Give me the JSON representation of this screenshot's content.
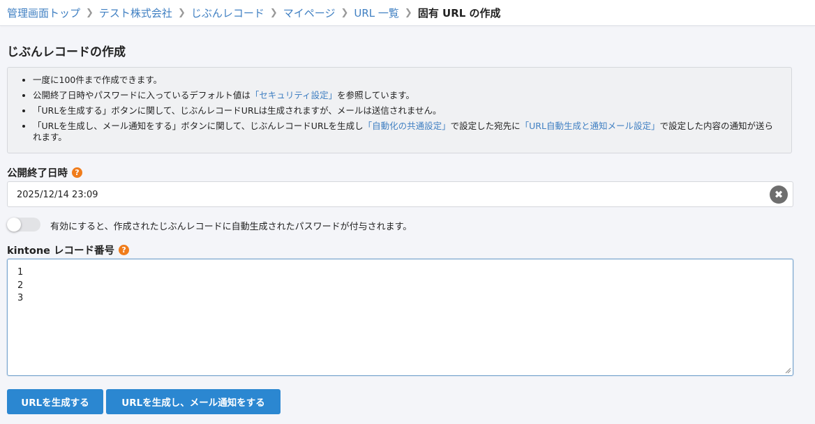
{
  "breadcrumb": {
    "items": [
      "管理画面トップ",
      "テスト株式会社",
      "じぶんレコード",
      "マイページ",
      "URL 一覧"
    ],
    "current": "固有 URL の作成"
  },
  "page_title": "じぶんレコードの作成",
  "notice": {
    "item1": "一度に100件まで作成できます。",
    "item2_pre": "公開終了日時やパスワードに入っているデフォルト値は",
    "item2_link": "「セキュリティ設定」",
    "item2_post": "を参照しています。",
    "item3": "「URLを生成する」ボタンに関して、じぶんレコードURLは生成されますが、メールは送信されません。",
    "item4_pre": "「URLを生成し、メール通知をする」ボタンに関して、じぶんレコードURLを生成し",
    "item4_link1": "「自動化の共通設定」",
    "item4_mid": "で設定した宛先に",
    "item4_link2": "「URL自動生成と通知メール設定」",
    "item4_post": "で設定した内容の通知が送られます。"
  },
  "expiry": {
    "label": "公開終了日時",
    "value": "2025/12/14 23:09"
  },
  "password_toggle": {
    "label": "有効にすると、作成されたじぶんレコードに自動生成されたパスワードが付与されます。",
    "enabled": false
  },
  "record_numbers": {
    "label": "kintone レコード番号",
    "value": "1\n2\n3"
  },
  "buttons": {
    "generate": "URLを生成する",
    "generate_notify": "URLを生成し、メール通知をする"
  },
  "colors": {
    "primary": "#2b87d1",
    "link": "#3f7fc2",
    "help": "#f07c1b",
    "background": "#f4f5f9"
  },
  "icons": {
    "breadcrumb_separator": "chevron-right-icon",
    "help": "question-circle-icon",
    "clear": "clear-x-icon"
  }
}
